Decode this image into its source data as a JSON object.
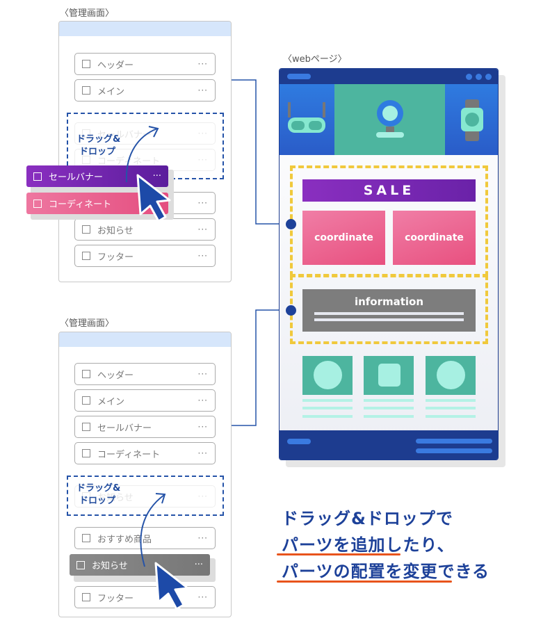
{
  "admin_top": {
    "title": "〈管理画面〉",
    "items": [
      "ヘッダー",
      "メイン",
      "",
      "お知らせ",
      "フッター"
    ],
    "placeholder_slots": [
      "セールバナー",
      "コーディネート"
    ],
    "dragged": [
      "セールバナー",
      "コーディネート"
    ],
    "drag_label_1": "ドラッグ&",
    "drag_label_2": "ドロップ",
    "menu": "···"
  },
  "admin_bottom": {
    "title": "〈管理画面〉",
    "items": [
      "ヘッダー",
      "メイン",
      "セールバナー",
      "コーディネート",
      "おすすめ商品",
      "フッター"
    ],
    "placeholder_slot": "お知らせ",
    "dragged": "お知らせ",
    "drag_label_1": "ドラッグ&",
    "drag_label_2": "ドロップ",
    "menu": "···"
  },
  "webpage": {
    "title": "〈webページ〉",
    "sale": "SALE",
    "coordinate_1": "coordinate",
    "coordinate_2": "coordinate",
    "information": "information",
    "hero_icons": [
      "glasses-icon",
      "webcam-icon",
      "smartwatch-icon"
    ]
  },
  "caption": {
    "line1": "ドラッグ&ドロップで",
    "line2_a": "パーツを追加",
    "line2_b": "したり、",
    "line3_a": "パーツの配置を変更",
    "line3_b": "できる"
  },
  "colors": {
    "accent": "#1d4199",
    "purple": "#7b2bb5",
    "pink": "#ec6b96",
    "teal": "#4db59f",
    "yellow": "#f0c93c",
    "orange": "#e8541c"
  }
}
